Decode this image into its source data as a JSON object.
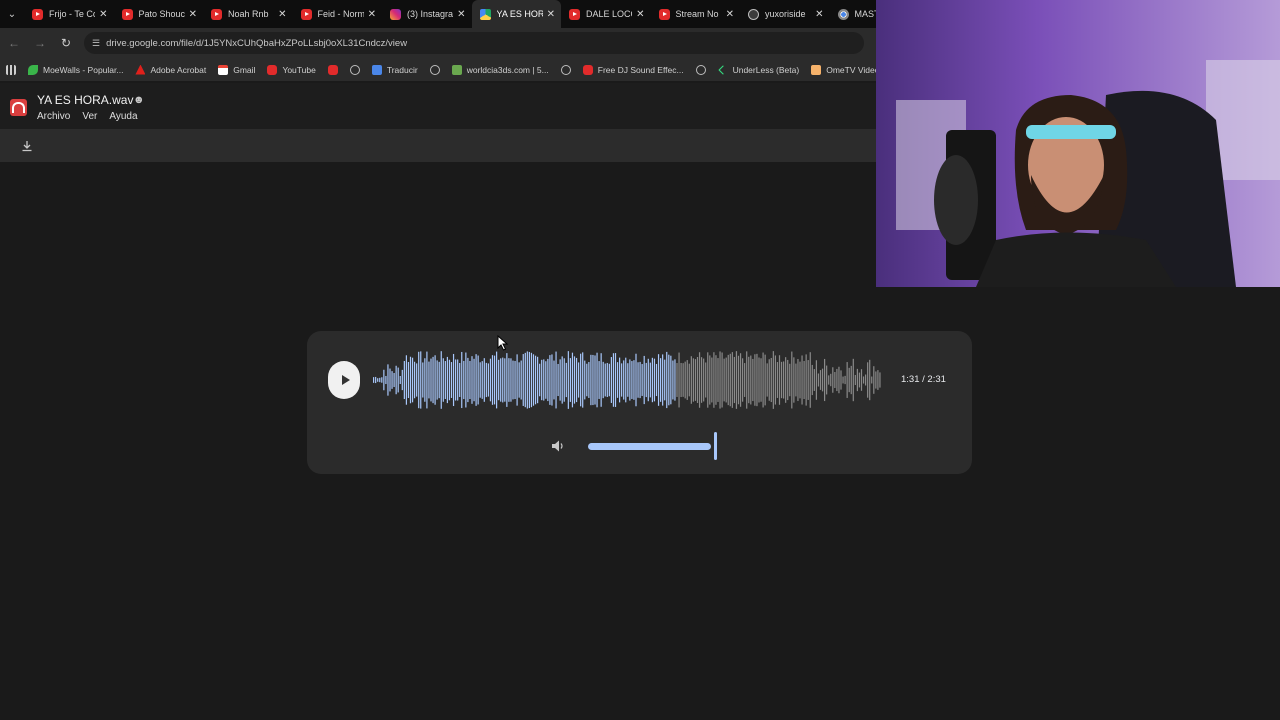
{
  "tabs": [
    {
      "label": "Frijo - Te Co",
      "icon": "youtube-icon",
      "active": false
    },
    {
      "label": "Pato Shouc",
      "icon": "youtube-icon",
      "active": false
    },
    {
      "label": "Noah Rnb",
      "icon": "youtube-icon",
      "active": false
    },
    {
      "label": "Feid - Norm",
      "icon": "youtube-icon",
      "active": false
    },
    {
      "label": "(3) Instagra",
      "icon": "instagram-icon",
      "active": false
    },
    {
      "label": "YA ES HOR/",
      "icon": "drive-icon",
      "active": true
    },
    {
      "label": "DALE LOCO",
      "icon": "youtube-icon",
      "active": false
    },
    {
      "label": "Stream No",
      "icon": "youtube-icon",
      "active": false
    },
    {
      "label": "yuxoriside",
      "icon": "globe-icon",
      "active": false
    },
    {
      "label": "MASTI",
      "icon": "chrome-icon",
      "active": false
    }
  ],
  "address_bar": {
    "url": "drive.google.com/file/d/1J5YNxCUhQbaHxZPoLLsbj0oXL31Cndcz/view"
  },
  "bookmarks": [
    {
      "label": "",
      "icon": "apps-icon"
    },
    {
      "label": "MoeWalls - Popular...",
      "icon": "leaf-icon"
    },
    {
      "label": "Adobe Acrobat",
      "icon": "acrobat-icon"
    },
    {
      "label": "Gmail",
      "icon": "gmail-icon"
    },
    {
      "label": "YouTube",
      "icon": "youtube-icon"
    },
    {
      "label": "",
      "icon": "youtube-icon"
    },
    {
      "label": "",
      "icon": "globe-icon"
    },
    {
      "label": "Traducir",
      "icon": "translate-icon"
    },
    {
      "label": "",
      "icon": "globe-icon"
    },
    {
      "label": "worldcia3ds.com | 5...",
      "icon": "image-icon"
    },
    {
      "label": "",
      "icon": "globe-icon"
    },
    {
      "label": "Free DJ Sound Effec...",
      "icon": "youtube-icon"
    },
    {
      "label": "",
      "icon": "globe-icon"
    },
    {
      "label": "UnderLess (Beta)",
      "icon": "chevron-icon"
    },
    {
      "label": "OmeTV Video Chat...",
      "icon": "video-chat-icon"
    }
  ],
  "viewer": {
    "file_name": "YA ES HORA.wav",
    "menu": [
      "Archivo",
      "Ver",
      "Ayuda"
    ]
  },
  "player": {
    "time": "1:31 / 2:31",
    "progress_fraction": 0.6,
    "volume_fraction": 0.95,
    "played_color": "#a8c7fa",
    "unplayed_color": "#8a8a8a"
  }
}
